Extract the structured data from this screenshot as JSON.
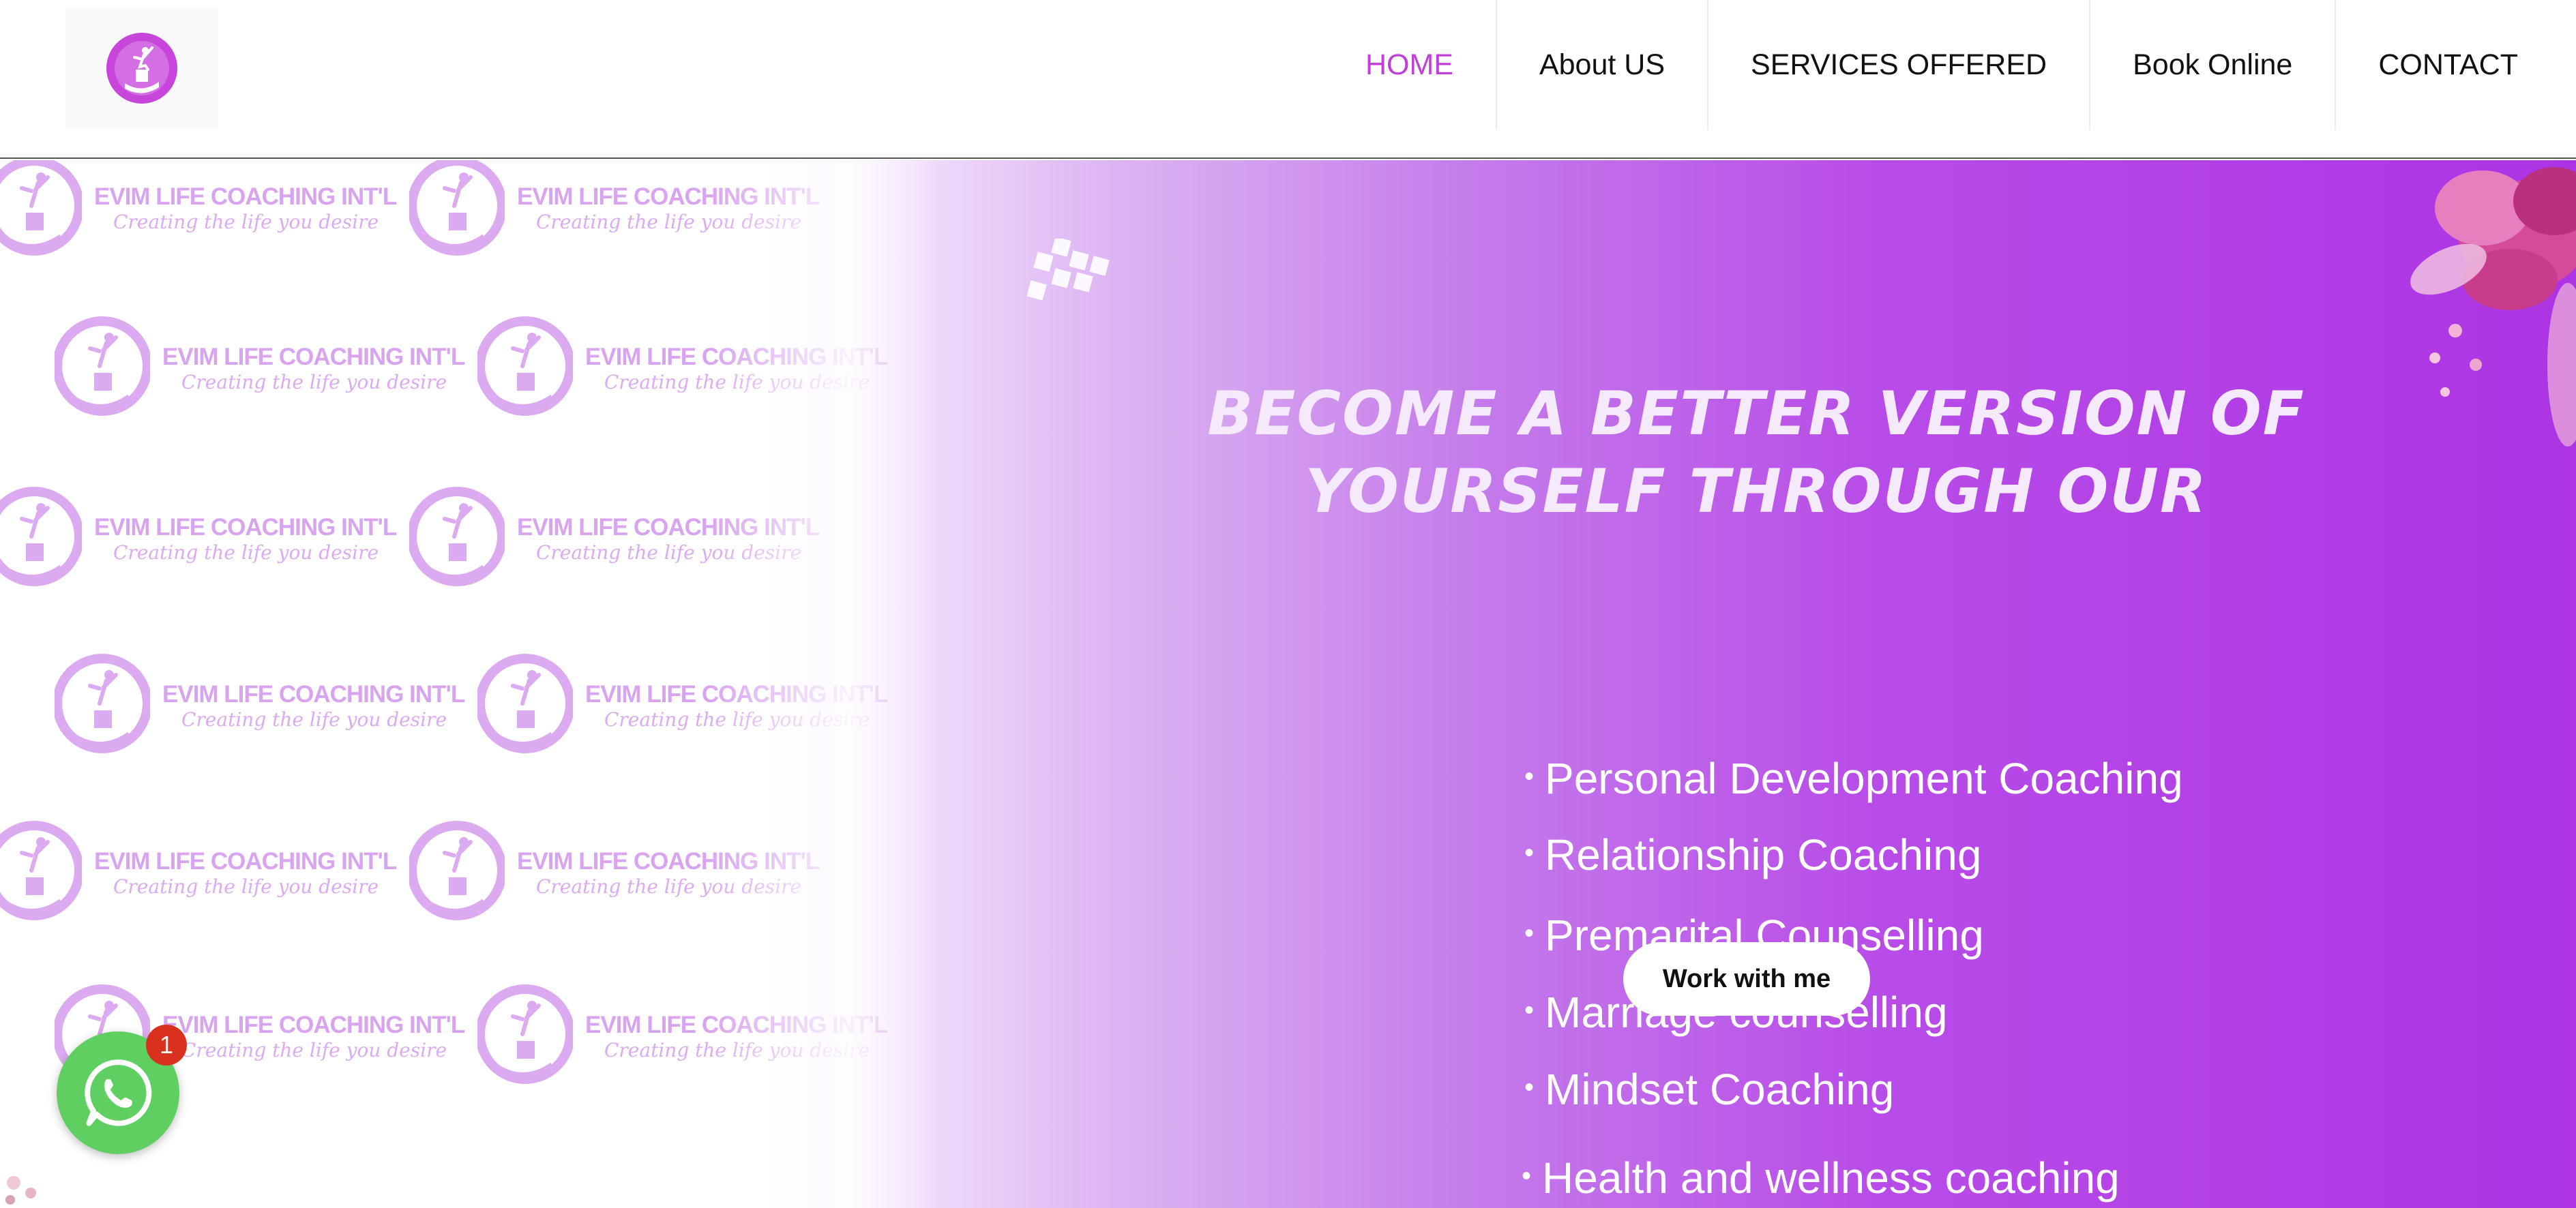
{
  "header": {
    "nav": [
      {
        "label": "HOME",
        "active": true
      },
      {
        "label": "About US",
        "active": false
      },
      {
        "label": "SERVICES OFFERED",
        "active": false
      },
      {
        "label": "Book Online",
        "active": false
      },
      {
        "label": "CONTACT",
        "active": false
      }
    ],
    "active_color": "#c13fd8"
  },
  "pattern": {
    "title": "EVIM LIFE COACHING INT'L",
    "tagline": "Creating the life you desire",
    "color": "#d9a4ef"
  },
  "hero": {
    "title_line1": "BECOME A BETTER VERSION OF",
    "title_line2": "YOURSELF THROUGH OUR",
    "services": [
      "Personal Development Coaching",
      "Relationship Coaching",
      "Premarital Counselling",
      "Marriage counselling",
      "Mindset Coaching",
      "Health and wellness coaching"
    ],
    "cta_label": "Work with me",
    "gradient_colors": [
      "#ffffff",
      "#dcb2f2",
      "#ac34e4"
    ]
  },
  "whatsapp": {
    "badge_count": "1",
    "color": "#5fcf62",
    "badge_color": "#d8321f"
  }
}
